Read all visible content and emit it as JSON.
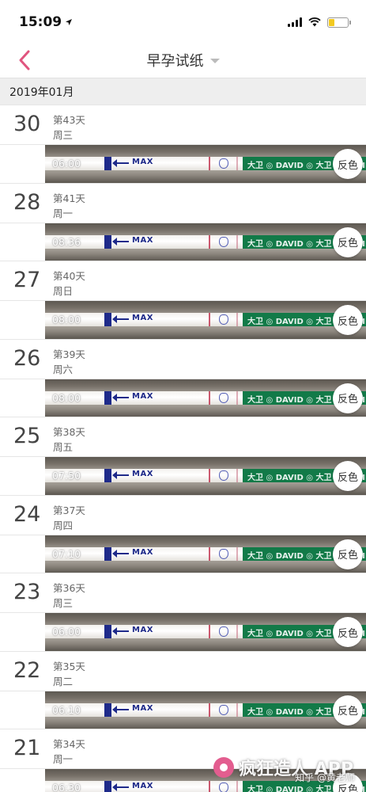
{
  "status": {
    "time": "15:09"
  },
  "nav": {
    "title": "早孕试纸"
  },
  "month": "2019年01月",
  "invert_label": "反色",
  "strip_text": "MAX",
  "days": [
    {
      "day": "30",
      "label": "第43天",
      "weekday": "周三",
      "time": "06:00"
    },
    {
      "day": "28",
      "label": "第41天",
      "weekday": "周一",
      "time": "08:36"
    },
    {
      "day": "27",
      "label": "第40天",
      "weekday": "周日",
      "time": "08:00"
    },
    {
      "day": "26",
      "label": "第39天",
      "weekday": "周六",
      "time": "08:00"
    },
    {
      "day": "25",
      "label": "第38天",
      "weekday": "周五",
      "time": "07:50"
    },
    {
      "day": "24",
      "label": "第37天",
      "weekday": "周四",
      "time": "07:10"
    },
    {
      "day": "23",
      "label": "第36天",
      "weekday": "周三",
      "time": "06:00"
    },
    {
      "day": "22",
      "label": "第35天",
      "weekday": "周二",
      "time": "06:10"
    },
    {
      "day": "21",
      "label": "第34天",
      "weekday": "周一",
      "time": "06:30"
    }
  ],
  "watermark": {
    "title": "疯狂造人 APP",
    "sub": "知乎 @黄老师"
  },
  "colors": {
    "accent": "#e0557f",
    "strip_green": "#127a48",
    "max_blue": "#1e2a8a"
  },
  "icons": {
    "back": "chevron-left-icon",
    "caret": "caret-down-icon",
    "location": "location-arrow-icon"
  }
}
